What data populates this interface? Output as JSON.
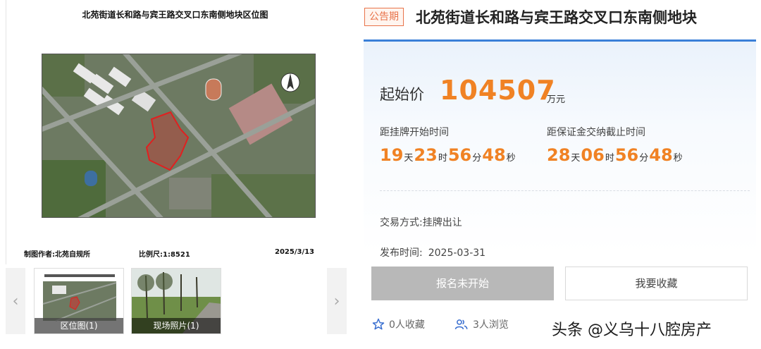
{
  "document": {
    "title": "北苑街道长和路与宾王路交叉口东南侧地块区位图",
    "maker": "制图作者:北苑自规所",
    "scale": "比例尺:1:8521",
    "date": "2025/3/13"
  },
  "gallery": {
    "thumbnails": [
      {
        "label": "区位图(1)"
      },
      {
        "label": "现场照片(1)"
      }
    ],
    "prev_icon": "chevron-left-icon",
    "next_icon": "chevron-right-icon"
  },
  "listing": {
    "status_badge": "公告期",
    "title": "北苑街道长和路与宾王路交叉口东南侧地块",
    "price_label": "起始价",
    "price_value": "104507",
    "price_unit": "万元",
    "countdown_listing": {
      "label": "距挂牌开始时间",
      "days": "19",
      "hours": "23",
      "minutes": "56",
      "seconds": "48",
      "unit_day": "天",
      "unit_hour": "时",
      "unit_minute": "分",
      "unit_second": "秒"
    },
    "countdown_deposit": {
      "label": "距保证金交纳截止时间",
      "days": "28",
      "hours": "06",
      "minutes": "56",
      "seconds": "48",
      "unit_day": "天",
      "unit_hour": "时",
      "unit_minute": "分",
      "unit_second": "秒"
    },
    "trade_method_label": "交易方式:",
    "trade_method_value": "挂牌出让",
    "publish_time_label": "发布时间:",
    "publish_time_value": "2025-03-31"
  },
  "actions": {
    "signup_label": "报名未开始",
    "favorite_label": "我要收藏"
  },
  "stats": {
    "favorites": "0人收藏",
    "views": "3人浏览"
  },
  "watermark": "头条 @义乌十八腔房产",
  "colors": {
    "accent": "#f08224",
    "badge": "#e8734a",
    "blue_line": "#3a7fd8",
    "disabled_button": "#b8b8b8"
  }
}
